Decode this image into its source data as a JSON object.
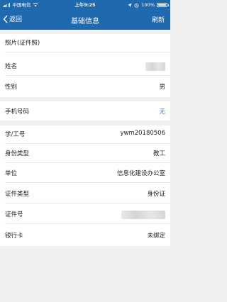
{
  "status_bar": {
    "carrier": "中国电信",
    "time": "上午9:25",
    "battery": "100%",
    "icons": [
      "signal-icon",
      "wifi-icon",
      "location-icon",
      "alarm-icon",
      "battery-icon"
    ]
  },
  "nav": {
    "back_label": "返回",
    "title": "基础信息",
    "refresh_label": "刷新"
  },
  "fields": {
    "photo": {
      "label": "照片(证件照)"
    },
    "name": {
      "label": "姓名",
      "value_redacted": true
    },
    "gender": {
      "label": "性别",
      "value": "男"
    },
    "phone": {
      "label": "手机号码",
      "value": "无"
    },
    "student_id": {
      "label": "学/工号",
      "value": "ywm20180506"
    },
    "identity_type": {
      "label": "身份类型",
      "value": "教工"
    },
    "unit": {
      "label": "单位",
      "value": "信息化建设办公室"
    },
    "id_type": {
      "label": "证件类型",
      "value": "身份证"
    },
    "id_number": {
      "label": "证件号",
      "value_redacted": true
    },
    "bank_card": {
      "label": "银行卡",
      "value": "未绑定"
    }
  },
  "colors": {
    "header_bg": "#1f69ae",
    "page_bg": "#f0f0f0",
    "accent_blue": "#3c80c6"
  }
}
